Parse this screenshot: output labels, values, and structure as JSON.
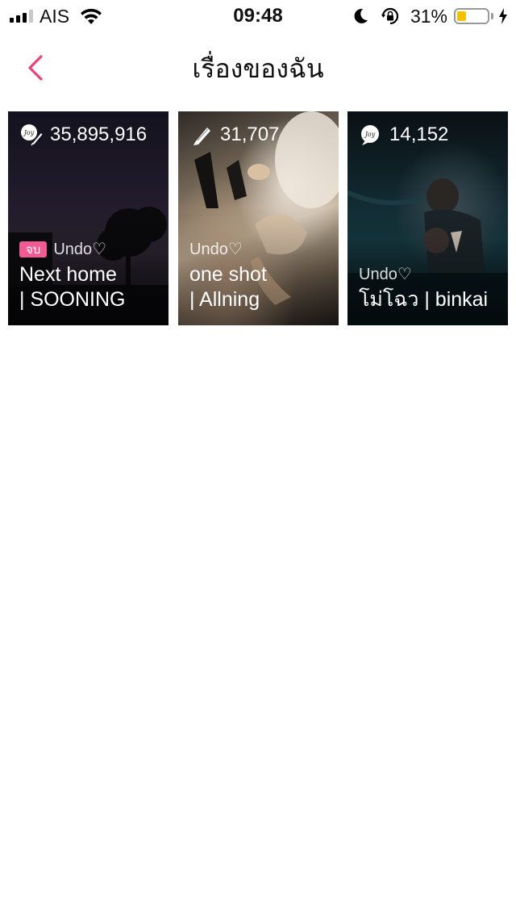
{
  "status_bar": {
    "carrier": "AIS",
    "time": "09:48",
    "battery_percent_text": "31%",
    "battery_level": 0.31,
    "signal_bars_active": 3,
    "signal_bars_total": 4
  },
  "nav": {
    "title": "เรื่องของฉัน",
    "back_icon": "chevron-left-icon",
    "accent_color": "#e8437a"
  },
  "stories": [
    {
      "stat_icon": "joylada-feather-icon",
      "count": "35,895,916",
      "badge": "จบ",
      "author": "Undo♡",
      "title_line1": "Next home",
      "title_line2": "| SOONING"
    },
    {
      "stat_icon": "pen-icon",
      "count": "31,707",
      "author": "Undo♡",
      "title_line1": "one shot",
      "title_line2": "| Allning"
    },
    {
      "stat_icon": "joylada-bubble-icon",
      "count": "14,152",
      "author": "Undo♡",
      "title_line1": "โม่โฉว | binkai"
    }
  ],
  "colors": {
    "badge": "#f05b94",
    "battery_fill": "#f2c200"
  }
}
